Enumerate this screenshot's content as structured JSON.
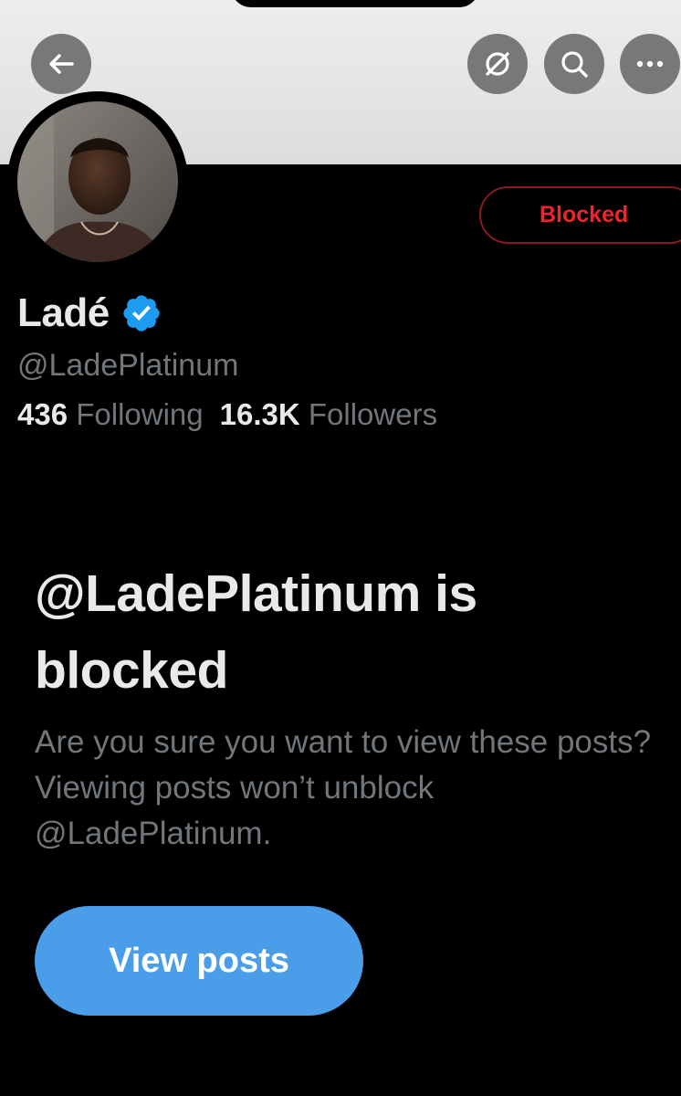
{
  "header": {
    "back_icon": "arrow-left-icon",
    "actions": [
      {
        "icon": "translate-circle-icon"
      },
      {
        "icon": "search-icon"
      },
      {
        "icon": "more-dots-icon"
      }
    ]
  },
  "profile": {
    "display_name": "Ladé",
    "verified_icon": "verified-badge-icon",
    "handle": "@LadePlatinum",
    "following_count": "436",
    "following_label": "Following",
    "followers_count": "16.3K",
    "followers_label": "Followers",
    "blocked_button_label": "Blocked"
  },
  "block_notice": {
    "title": "@LadePlatinum is blocked",
    "description": "Are you sure you want to view these posts? Viewing posts won’t unblock @LadePlatinum.",
    "view_button_label": "View posts"
  },
  "colors": {
    "background": "#000000",
    "blocked_red": "#f4212e",
    "verified_blue": "#1d9bf0",
    "view_button_blue": "#4a9ee9",
    "muted_text": "#71767b"
  }
}
